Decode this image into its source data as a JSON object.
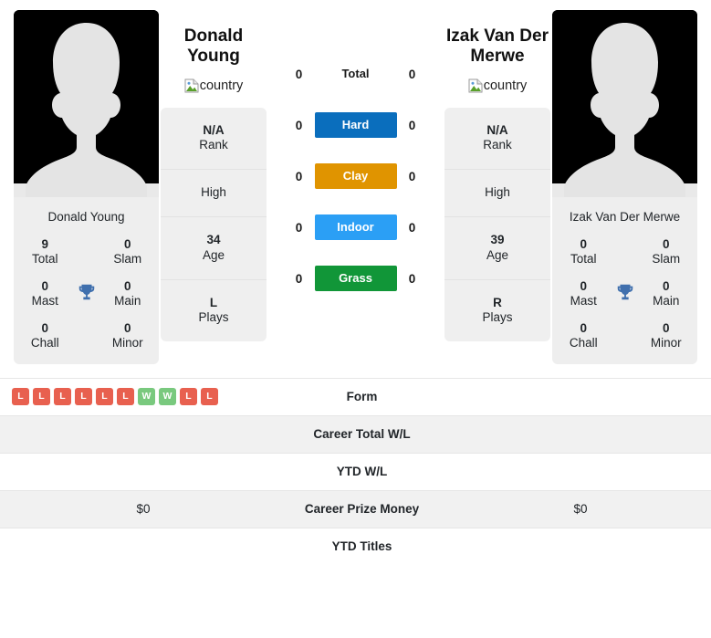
{
  "players": {
    "left": {
      "name": "Donald Young",
      "name_display": "Donald\nYoung",
      "flag_alt": "country",
      "avatar_alt": "player photo",
      "titles": {
        "total": {
          "value": "9",
          "label": "Total"
        },
        "slam": {
          "value": "0",
          "label": "Slam"
        },
        "mast": {
          "value": "0",
          "label": "Mast"
        },
        "main": {
          "value": "0",
          "label": "Main"
        },
        "chall": {
          "value": "0",
          "label": "Chall"
        },
        "minor": {
          "value": "0",
          "label": "Minor"
        }
      },
      "info": {
        "rank": {
          "value": "N/A",
          "label": "Rank"
        },
        "high": {
          "value": "High"
        },
        "age": {
          "value": "34",
          "label": "Age"
        },
        "plays": {
          "value": "L",
          "label": "Plays"
        }
      },
      "form": [
        "L",
        "L",
        "L",
        "L",
        "L",
        "L",
        "W",
        "W",
        "L",
        "L"
      ],
      "career_total_wl": "",
      "ytd_wl": "",
      "career_prize_money": "$0",
      "ytd_titles": ""
    },
    "right": {
      "name": "Izak Van Der Merwe",
      "name_display": "Izak Van Der\nMerwe",
      "flag_alt": "country",
      "avatar_alt": "player photo",
      "titles": {
        "total": {
          "value": "0",
          "label": "Total"
        },
        "slam": {
          "value": "0",
          "label": "Slam"
        },
        "mast": {
          "value": "0",
          "label": "Mast"
        },
        "main": {
          "value": "0",
          "label": "Main"
        },
        "chall": {
          "value": "0",
          "label": "Chall"
        },
        "minor": {
          "value": "0",
          "label": "Minor"
        }
      },
      "info": {
        "rank": {
          "value": "N/A",
          "label": "Rank"
        },
        "high": {
          "value": "High"
        },
        "age": {
          "value": "39",
          "label": "Age"
        },
        "plays": {
          "value": "R",
          "label": "Plays"
        }
      },
      "form": [],
      "career_total_wl": "",
      "ytd_wl": "",
      "career_prize_money": "$0",
      "ytd_titles": ""
    }
  },
  "surfaces": [
    {
      "key": "total",
      "label": "Total",
      "left": "0",
      "right": "0",
      "color": "transparent",
      "plain": true
    },
    {
      "key": "hard",
      "label": "Hard",
      "left": "0",
      "right": "0",
      "color": "#0a6ebd",
      "plain": false
    },
    {
      "key": "clay",
      "label": "Clay",
      "left": "0",
      "right": "0",
      "color": "#e09400",
      "plain": false
    },
    {
      "key": "indoor",
      "label": "Indoor",
      "left": "0",
      "right": "0",
      "color": "#2b9ff5",
      "plain": false
    },
    {
      "key": "grass",
      "label": "Grass",
      "left": "0",
      "right": "0",
      "color": "#119638",
      "plain": false
    }
  ],
  "table_rows": [
    {
      "key": "form",
      "label": "Form",
      "striped": false,
      "type": "badges"
    },
    {
      "key": "career_total_wl",
      "label": "Career Total W/L",
      "striped": true,
      "type": "text"
    },
    {
      "key": "ytd_wl",
      "label": "YTD W/L",
      "striped": false,
      "type": "text"
    },
    {
      "key": "career_prize_money",
      "label": "Career Prize Money",
      "striped": true,
      "type": "text"
    },
    {
      "key": "ytd_titles",
      "label": "YTD Titles",
      "striped": false,
      "type": "text"
    }
  ],
  "colors": {
    "win_badge": "#e8604f",
    "loss_badge": "#e8604f",
    "badge_win": "#79c97e",
    "badge_loss": "#e8604f",
    "trophy": "#3f6fad",
    "card_bg": "#eeeeee",
    "stripe_bg": "#f1f1f1"
  },
  "icons": {
    "trophy": "trophy-icon",
    "broken_image": "broken-image-icon"
  }
}
